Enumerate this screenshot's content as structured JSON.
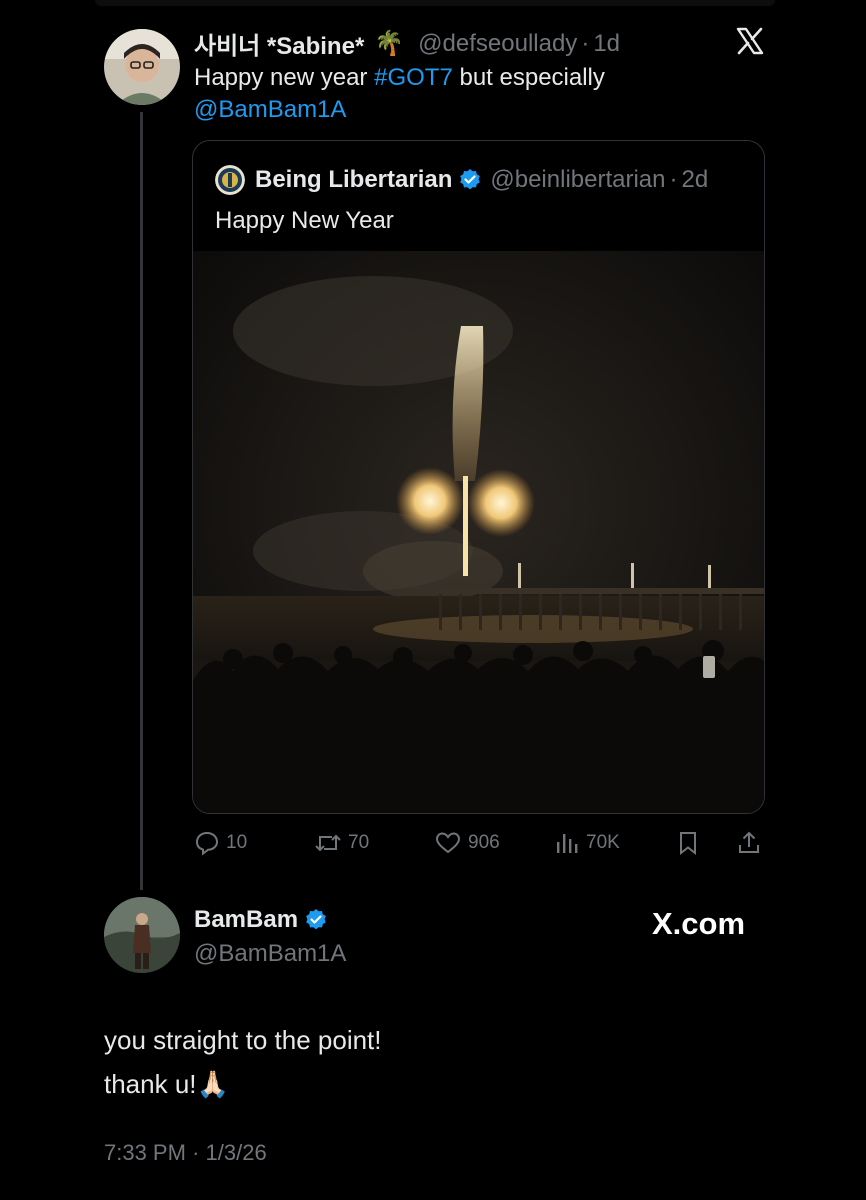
{
  "first_tweet": {
    "display_name": "사비너 *Sabine*",
    "name_emoji": "🌴",
    "handle": "@defseoullady",
    "separator": "·",
    "time_ago": "1d",
    "text_plain": "Happy new year ",
    "hashtag": "#GOT7",
    "text_after": " but especially",
    "mention": "@BamBam1A"
  },
  "quoted_tweet": {
    "display_name": "Being Libertarian",
    "handle": "@beinlibertarian",
    "separator": "·",
    "time_ago": "2d",
    "text": "Happy New Year"
  },
  "actions": {
    "replies": "10",
    "reposts": "70",
    "likes": "906",
    "views": "70K"
  },
  "reply_tweet": {
    "display_name": "BamBam",
    "handle": "@BamBam1A",
    "line1": "you straight to the point!",
    "line2": "thank u!",
    "line2_emoji": "🙏🏻",
    "time": "7:33 PM",
    "separator": "·",
    "date": "1/3/26"
  },
  "watermark": "X.com",
  "icons": [
    "x-logo-icon",
    "verified-badge-icon",
    "reply-icon",
    "repost-icon",
    "like-icon",
    "views-icon",
    "bookmark-icon",
    "share-icon"
  ],
  "colors": {
    "background": "#000000",
    "text": "#e7e9ea",
    "muted": "#71767b",
    "link": "#1d9bf0",
    "border": "#2f3336"
  }
}
